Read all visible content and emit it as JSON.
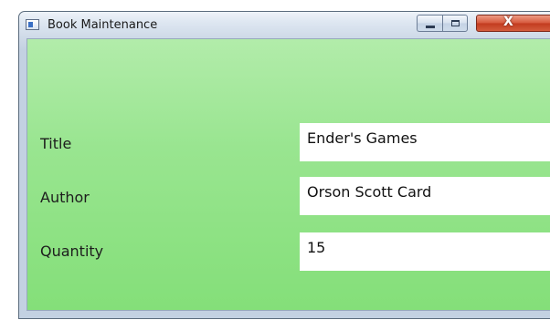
{
  "window": {
    "title": "Book Maintenance",
    "controls": {
      "minimize_icon": "minimize-icon",
      "maximize_icon": "maximize-icon",
      "close_icon": "close-icon",
      "close_glyph": "X"
    }
  },
  "form": {
    "background_color": "#99e590",
    "fields": [
      {
        "label": "Title",
        "value": "Ender's Games"
      },
      {
        "label": "Author",
        "value": "Orson Scott Card"
      },
      {
        "label": "Quantity",
        "value": "15"
      }
    ]
  }
}
